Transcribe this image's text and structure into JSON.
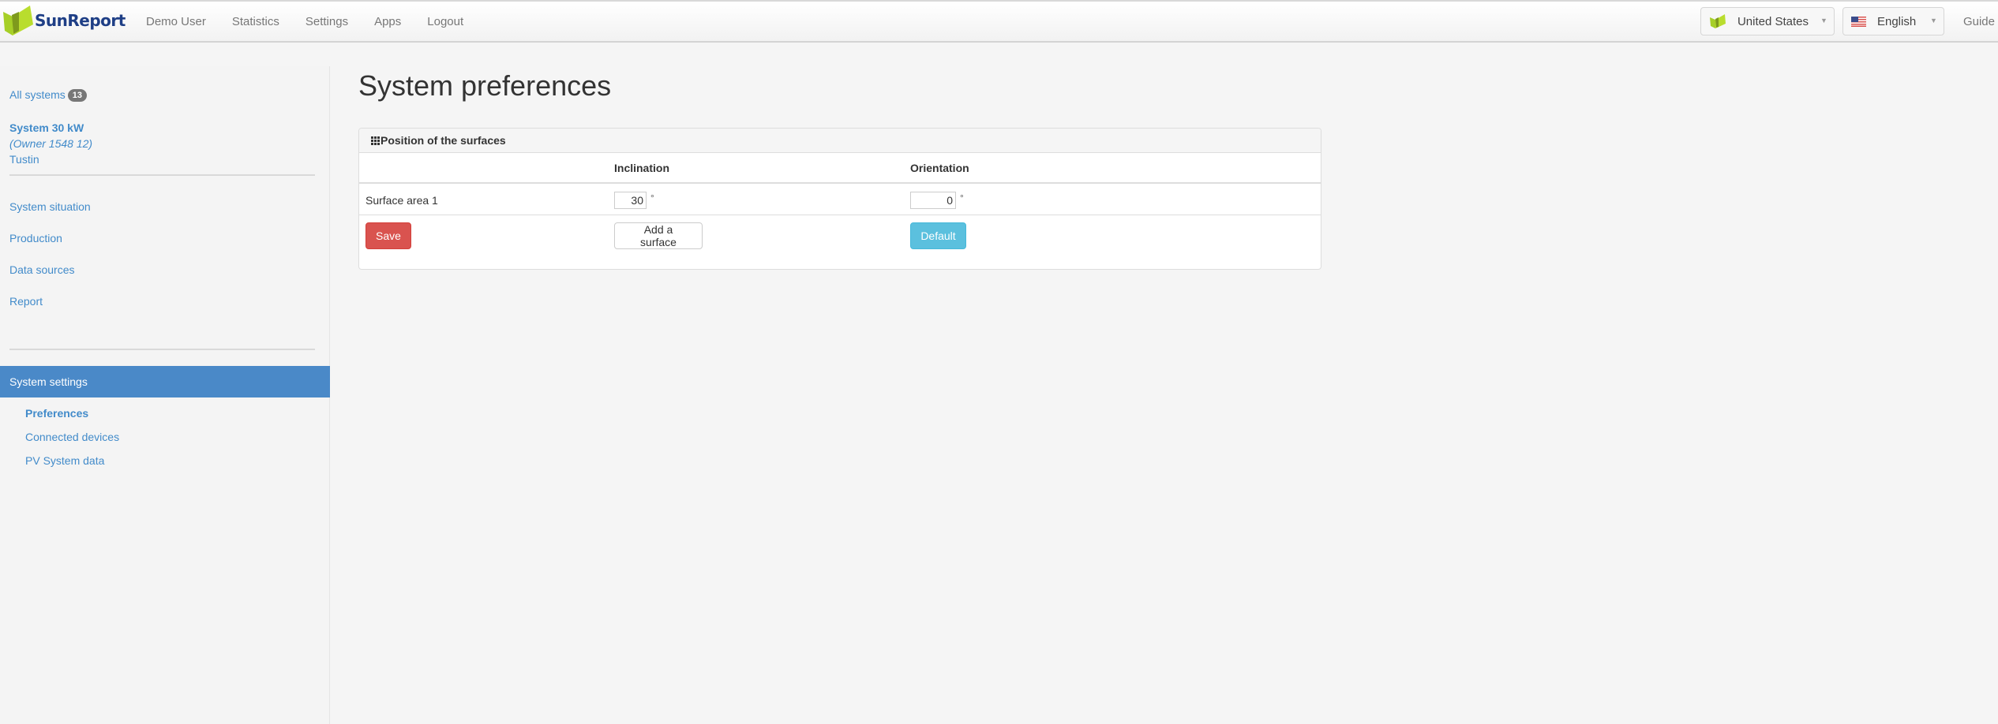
{
  "navbar": {
    "brand": "SunReport",
    "links": [
      "Demo User",
      "Statistics",
      "Settings",
      "Apps",
      "Logout"
    ],
    "country_select": {
      "value": "United States",
      "icon": "sunreport-leaf-icon"
    },
    "language_select": {
      "value": "English",
      "icon": "us-flag-icon"
    },
    "guide": "Guide"
  },
  "sidebar": {
    "all_systems_label": "All systems",
    "all_systems_count": "13",
    "system": {
      "name": "System 30 kW",
      "owner": "(Owner 1548 12)",
      "city": "Tustin"
    },
    "items": [
      "System situation",
      "Production",
      "Data sources",
      "Report"
    ],
    "active_section": "System settings",
    "sub_items": [
      "Preferences",
      "Connected devices",
      "PV System data"
    ]
  },
  "main": {
    "title": "System preferences",
    "panel": {
      "title": "Position of the surfaces",
      "icon": "grid-icon",
      "columns": [
        "",
        "Inclination",
        "Orientation"
      ],
      "rows": [
        {
          "label": "Surface area 1",
          "inclination": "30",
          "orientation": "0",
          "unit": "°"
        }
      ],
      "buttons": {
        "save": "Save",
        "add": "Add a surface",
        "default": "Default"
      }
    }
  },
  "colors": {
    "link": "#428bca",
    "active": "#4a89c8",
    "danger": "#d9534f",
    "info": "#5bc0de",
    "brand_green": "#a6cf27",
    "brand_blue": "#1f3f86"
  }
}
